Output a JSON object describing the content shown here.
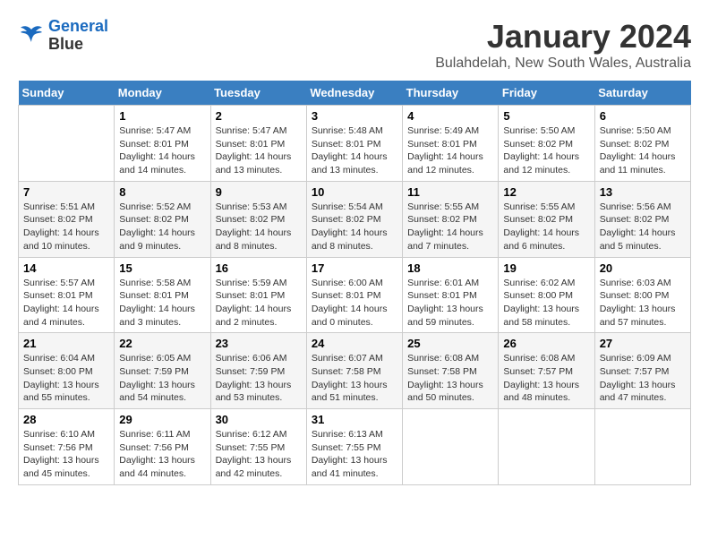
{
  "logo": {
    "line1": "General",
    "line2": "Blue"
  },
  "title": "January 2024",
  "subtitle": "Bulahdelah, New South Wales, Australia",
  "days_of_week": [
    "Sunday",
    "Monday",
    "Tuesday",
    "Wednesday",
    "Thursday",
    "Friday",
    "Saturday"
  ],
  "weeks": [
    [
      {
        "day": "",
        "info": ""
      },
      {
        "day": "1",
        "info": "Sunrise: 5:47 AM\nSunset: 8:01 PM\nDaylight: 14 hours\nand 14 minutes."
      },
      {
        "day": "2",
        "info": "Sunrise: 5:47 AM\nSunset: 8:01 PM\nDaylight: 14 hours\nand 13 minutes."
      },
      {
        "day": "3",
        "info": "Sunrise: 5:48 AM\nSunset: 8:01 PM\nDaylight: 14 hours\nand 13 minutes."
      },
      {
        "day": "4",
        "info": "Sunrise: 5:49 AM\nSunset: 8:01 PM\nDaylight: 14 hours\nand 12 minutes."
      },
      {
        "day": "5",
        "info": "Sunrise: 5:50 AM\nSunset: 8:02 PM\nDaylight: 14 hours\nand 12 minutes."
      },
      {
        "day": "6",
        "info": "Sunrise: 5:50 AM\nSunset: 8:02 PM\nDaylight: 14 hours\nand 11 minutes."
      }
    ],
    [
      {
        "day": "7",
        "info": "Sunrise: 5:51 AM\nSunset: 8:02 PM\nDaylight: 14 hours\nand 10 minutes."
      },
      {
        "day": "8",
        "info": "Sunrise: 5:52 AM\nSunset: 8:02 PM\nDaylight: 14 hours\nand 9 minutes."
      },
      {
        "day": "9",
        "info": "Sunrise: 5:53 AM\nSunset: 8:02 PM\nDaylight: 14 hours\nand 8 minutes."
      },
      {
        "day": "10",
        "info": "Sunrise: 5:54 AM\nSunset: 8:02 PM\nDaylight: 14 hours\nand 8 minutes."
      },
      {
        "day": "11",
        "info": "Sunrise: 5:55 AM\nSunset: 8:02 PM\nDaylight: 14 hours\nand 7 minutes."
      },
      {
        "day": "12",
        "info": "Sunrise: 5:55 AM\nSunset: 8:02 PM\nDaylight: 14 hours\nand 6 minutes."
      },
      {
        "day": "13",
        "info": "Sunrise: 5:56 AM\nSunset: 8:02 PM\nDaylight: 14 hours\nand 5 minutes."
      }
    ],
    [
      {
        "day": "14",
        "info": "Sunrise: 5:57 AM\nSunset: 8:01 PM\nDaylight: 14 hours\nand 4 minutes."
      },
      {
        "day": "15",
        "info": "Sunrise: 5:58 AM\nSunset: 8:01 PM\nDaylight: 14 hours\nand 3 minutes."
      },
      {
        "day": "16",
        "info": "Sunrise: 5:59 AM\nSunset: 8:01 PM\nDaylight: 14 hours\nand 2 minutes."
      },
      {
        "day": "17",
        "info": "Sunrise: 6:00 AM\nSunset: 8:01 PM\nDaylight: 14 hours\nand 0 minutes."
      },
      {
        "day": "18",
        "info": "Sunrise: 6:01 AM\nSunset: 8:01 PM\nDaylight: 13 hours\nand 59 minutes."
      },
      {
        "day": "19",
        "info": "Sunrise: 6:02 AM\nSunset: 8:00 PM\nDaylight: 13 hours\nand 58 minutes."
      },
      {
        "day": "20",
        "info": "Sunrise: 6:03 AM\nSunset: 8:00 PM\nDaylight: 13 hours\nand 57 minutes."
      }
    ],
    [
      {
        "day": "21",
        "info": "Sunrise: 6:04 AM\nSunset: 8:00 PM\nDaylight: 13 hours\nand 55 minutes."
      },
      {
        "day": "22",
        "info": "Sunrise: 6:05 AM\nSunset: 7:59 PM\nDaylight: 13 hours\nand 54 minutes."
      },
      {
        "day": "23",
        "info": "Sunrise: 6:06 AM\nSunset: 7:59 PM\nDaylight: 13 hours\nand 53 minutes."
      },
      {
        "day": "24",
        "info": "Sunrise: 6:07 AM\nSunset: 7:58 PM\nDaylight: 13 hours\nand 51 minutes."
      },
      {
        "day": "25",
        "info": "Sunrise: 6:08 AM\nSunset: 7:58 PM\nDaylight: 13 hours\nand 50 minutes."
      },
      {
        "day": "26",
        "info": "Sunrise: 6:08 AM\nSunset: 7:57 PM\nDaylight: 13 hours\nand 48 minutes."
      },
      {
        "day": "27",
        "info": "Sunrise: 6:09 AM\nSunset: 7:57 PM\nDaylight: 13 hours\nand 47 minutes."
      }
    ],
    [
      {
        "day": "28",
        "info": "Sunrise: 6:10 AM\nSunset: 7:56 PM\nDaylight: 13 hours\nand 45 minutes."
      },
      {
        "day": "29",
        "info": "Sunrise: 6:11 AM\nSunset: 7:56 PM\nDaylight: 13 hours\nand 44 minutes."
      },
      {
        "day": "30",
        "info": "Sunrise: 6:12 AM\nSunset: 7:55 PM\nDaylight: 13 hours\nand 42 minutes."
      },
      {
        "day": "31",
        "info": "Sunrise: 6:13 AM\nSunset: 7:55 PM\nDaylight: 13 hours\nand 41 minutes."
      },
      {
        "day": "",
        "info": ""
      },
      {
        "day": "",
        "info": ""
      },
      {
        "day": "",
        "info": ""
      }
    ]
  ]
}
